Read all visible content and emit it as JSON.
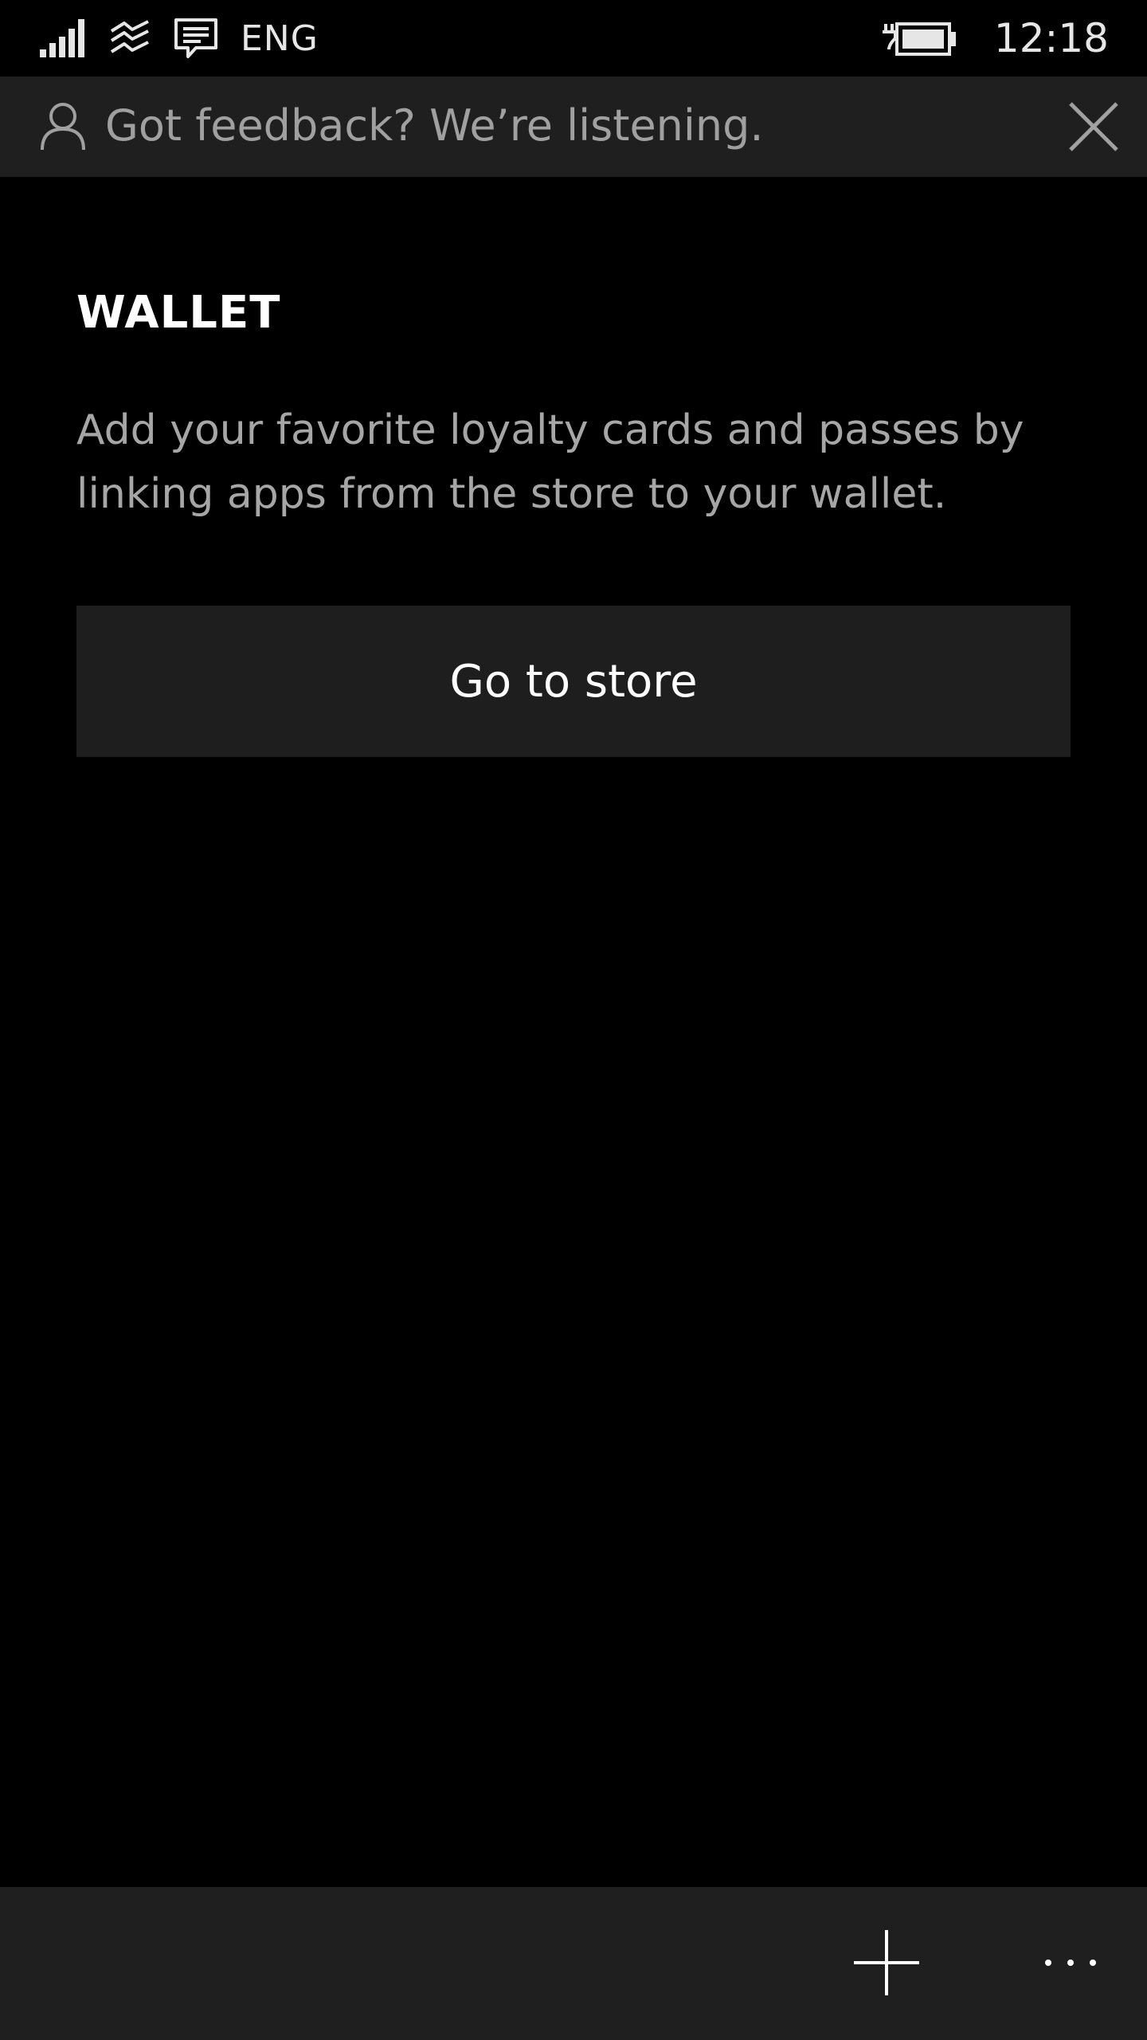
{
  "status_bar": {
    "language": "ENG",
    "time": "12:18",
    "icons": [
      "signal-strength-icon",
      "wifi-icon",
      "message-icon",
      "battery-charging-icon"
    ]
  },
  "feedback_banner": {
    "text": "Got feedback? We’re listening.",
    "icons": [
      "person-icon",
      "close-icon"
    ]
  },
  "page": {
    "title": "WALLET",
    "description": "Add your favorite loyalty cards and passes by linking apps from the store to your wallet.",
    "store_button_label": "Go to store"
  },
  "app_bar": {
    "icons": [
      "add-icon",
      "more-icon"
    ]
  },
  "colors": {
    "background": "#000000",
    "banner_background": "#1f1f1f",
    "button_background": "#1e1e1e",
    "secondary_text": "#a6a6a6",
    "primary_text": "#ffffff"
  }
}
